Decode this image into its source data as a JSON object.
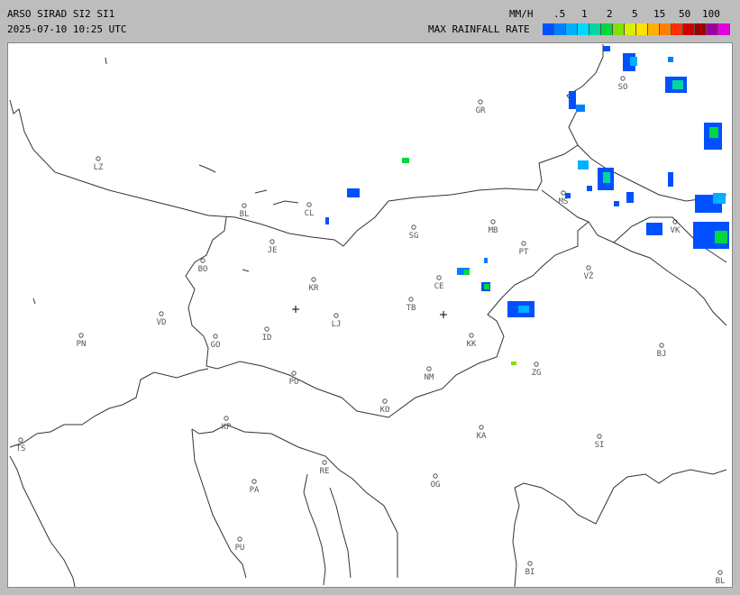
{
  "header": {
    "title": "ARSO SIRAD SI2 SI1",
    "timestamp": "2025-07-10 10:25 UTC"
  },
  "legend": {
    "unit": "MM/H",
    "label": "MAX RAINFALL RATE",
    "ticks": [
      ".5",
      "1",
      "2",
      "5",
      "15",
      "50",
      "100"
    ],
    "colors": [
      "#0050ff",
      "#0080ff",
      "#00b0ff",
      "#00d8ff",
      "#00d8a0",
      "#00d840",
      "#80e000",
      "#d8f000",
      "#ffe000",
      "#ffb000",
      "#ff8000",
      "#ff3000",
      "#d00000",
      "#a00000",
      "#a000a0",
      "#e000e0"
    ]
  },
  "map": {
    "locations": [
      {
        "code": "GR"
      },
      {
        "code": "SO"
      },
      {
        "code": "LZ"
      },
      {
        "code": "BL"
      },
      {
        "code": "CL"
      },
      {
        "code": "MB"
      },
      {
        "code": "MS"
      },
      {
        "code": "VK"
      },
      {
        "code": "JE"
      },
      {
        "code": "SG"
      },
      {
        "code": "PT"
      },
      {
        "code": "BO"
      },
      {
        "code": "KR"
      },
      {
        "code": "CE"
      },
      {
        "code": "VŽ"
      },
      {
        "code": "VD"
      },
      {
        "code": "TB"
      },
      {
        "code": "LJ"
      },
      {
        "code": "PN"
      },
      {
        "code": "GO"
      },
      {
        "code": "ID"
      },
      {
        "code": "KK"
      },
      {
        "code": "BJ"
      },
      {
        "code": "PO"
      },
      {
        "code": "NM"
      },
      {
        "code": "ZG"
      },
      {
        "code": "KO"
      },
      {
        "code": "KP"
      },
      {
        "code": "KA"
      },
      {
        "code": "TS"
      },
      {
        "code": "SI"
      },
      {
        "code": "PA"
      },
      {
        "code": "RE"
      },
      {
        "code": "OG"
      },
      {
        "code": "PU"
      },
      {
        "code": "BI"
      },
      {
        "code": "BL"
      }
    ]
  }
}
